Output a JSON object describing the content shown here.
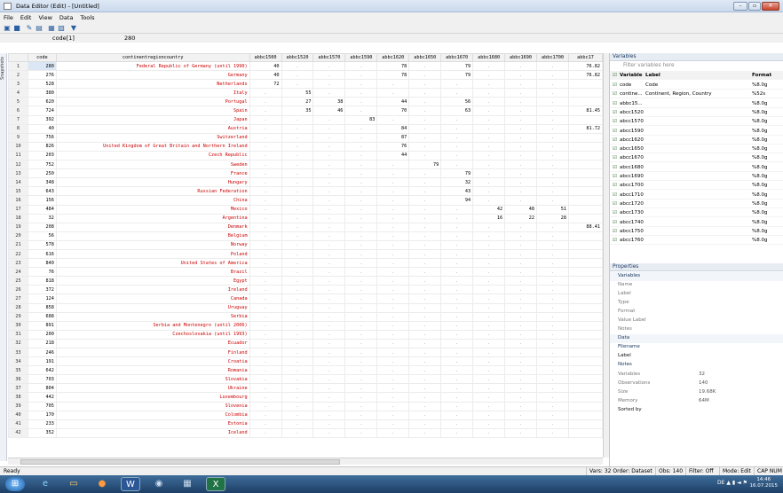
{
  "window": {
    "title": "Data Editor (Edit) - [Untitled]",
    "minimize": "–",
    "maximize": "▫",
    "close": "✕"
  },
  "menu": [
    "File",
    "Edit",
    "View",
    "Data",
    "Tools"
  ],
  "toolbar_icons": [
    "open-icon",
    "save-icon",
    "edit-icon",
    "browse-icon",
    "variables-icon",
    "properties-icon",
    "filter-icon"
  ],
  "edit_line": {
    "cell_ref": "code[1]",
    "cell_value": "280"
  },
  "snapshots_label": "Snapshots",
  "grid": {
    "columns": [
      "",
      "code",
      "continentregioncountry",
      "abbc1500",
      "abbc1520",
      "abbc1570",
      "abbc1590",
      "abbc1620",
      "abbc1650",
      "abbc1670",
      "abbc1680",
      "abbc1690",
      "abbc1700",
      "abbc17"
    ],
    "rows": [
      [
        "1",
        "280",
        "Federal Republic of Germany (until 1990)",
        "40",
        ".",
        ".",
        ".",
        "78",
        ".",
        "79",
        ".",
        ".",
        ".",
        "76.82"
      ],
      [
        "2",
        "276",
        "Germany",
        "40",
        ".",
        ".",
        ".",
        "78",
        ".",
        "79",
        ".",
        ".",
        ".",
        "76.82"
      ],
      [
        "3",
        "528",
        "Netherlands",
        "72",
        ".",
        ".",
        ".",
        ".",
        ".",
        ".",
        ".",
        ".",
        ".",
        ""
      ],
      [
        "4",
        "380",
        "Italy",
        ".",
        "55",
        ".",
        ".",
        ".",
        ".",
        ".",
        ".",
        ".",
        ".",
        ""
      ],
      [
        "5",
        "620",
        "Portugal",
        ".",
        "27",
        "38",
        ".",
        "44",
        ".",
        "56",
        ".",
        ".",
        ".",
        ""
      ],
      [
        "6",
        "724",
        "Spain",
        ".",
        "35",
        "46",
        ".",
        "70",
        ".",
        "63",
        ".",
        ".",
        ".",
        "81.45"
      ],
      [
        "7",
        "392",
        "Japan",
        ".",
        ".",
        ".",
        "83",
        ".",
        ".",
        ".",
        ".",
        ".",
        ".",
        ""
      ],
      [
        "8",
        "40",
        "Austria",
        ".",
        ".",
        ".",
        ".",
        "84",
        ".",
        ".",
        ".",
        ".",
        ".",
        "81.72"
      ],
      [
        "9",
        "756",
        "Switzerland",
        ".",
        ".",
        ".",
        ".",
        "87",
        ".",
        ".",
        ".",
        ".",
        ".",
        ""
      ],
      [
        "10",
        "826",
        "United Kingdom of Great Britain and Northern Ireland",
        ".",
        ".",
        ".",
        ".",
        "76",
        ".",
        ".",
        ".",
        ".",
        ".",
        ""
      ],
      [
        "11",
        "203",
        "Czech Republic",
        ".",
        ".",
        ".",
        ".",
        "44",
        ".",
        ".",
        ".",
        ".",
        ".",
        ""
      ],
      [
        "12",
        "752",
        "Sweden",
        ".",
        ".",
        ".",
        ".",
        ".",
        "79",
        ".",
        ".",
        ".",
        ".",
        ""
      ],
      [
        "13",
        "250",
        "France",
        ".",
        ".",
        ".",
        ".",
        ".",
        ".",
        "79",
        ".",
        ".",
        ".",
        ""
      ],
      [
        "14",
        "348",
        "Hungary",
        ".",
        ".",
        ".",
        ".",
        ".",
        ".",
        "32",
        ".",
        ".",
        ".",
        ""
      ],
      [
        "15",
        "643",
        "Russian Federation",
        ".",
        ".",
        ".",
        ".",
        ".",
        ".",
        "43",
        ".",
        ".",
        ".",
        ""
      ],
      [
        "16",
        "156",
        "China",
        ".",
        ".",
        ".",
        ".",
        ".",
        ".",
        "94",
        ".",
        ".",
        ".",
        ""
      ],
      [
        "17",
        "484",
        "Mexico",
        ".",
        ".",
        ".",
        ".",
        ".",
        ".",
        ".",
        "42",
        "48",
        "51",
        ""
      ],
      [
        "18",
        "32",
        "Argentina",
        ".",
        ".",
        ".",
        ".",
        ".",
        ".",
        ".",
        "16",
        "22",
        "28",
        ""
      ],
      [
        "19",
        "208",
        "Denmark",
        ".",
        ".",
        ".",
        ".",
        ".",
        ".",
        ".",
        ".",
        ".",
        ".",
        "88.41"
      ],
      [
        "20",
        "56",
        "Belgium",
        ".",
        ".",
        ".",
        ".",
        ".",
        ".",
        ".",
        ".",
        ".",
        ".",
        ""
      ],
      [
        "21",
        "578",
        "Norway",
        ".",
        ".",
        ".",
        ".",
        ".",
        ".",
        ".",
        ".",
        ".",
        ".",
        ""
      ],
      [
        "22",
        "616",
        "Poland",
        ".",
        ".",
        ".",
        ".",
        ".",
        ".",
        ".",
        ".",
        ".",
        ".",
        ""
      ],
      [
        "23",
        "840",
        "United States of America",
        ".",
        ".",
        ".",
        ".",
        ".",
        ".",
        ".",
        ".",
        ".",
        ".",
        ""
      ],
      [
        "24",
        "76",
        "Brazil",
        ".",
        ".",
        ".",
        ".",
        ".",
        ".",
        ".",
        ".",
        ".",
        ".",
        ""
      ],
      [
        "25",
        "818",
        "Egypt",
        ".",
        ".",
        ".",
        ".",
        ".",
        ".",
        ".",
        ".",
        ".",
        ".",
        ""
      ],
      [
        "26",
        "372",
        "Ireland",
        ".",
        ".",
        ".",
        ".",
        ".",
        ".",
        ".",
        ".",
        ".",
        ".",
        ""
      ],
      [
        "27",
        "124",
        "Canada",
        ".",
        ".",
        ".",
        ".",
        ".",
        ".",
        ".",
        ".",
        ".",
        ".",
        ""
      ],
      [
        "28",
        "858",
        "Uruguay",
        ".",
        ".",
        ".",
        ".",
        ".",
        ".",
        ".",
        ".",
        ".",
        ".",
        ""
      ],
      [
        "29",
        "688",
        "Serbia",
        ".",
        ".",
        ".",
        ".",
        ".",
        ".",
        ".",
        ".",
        ".",
        ".",
        ""
      ],
      [
        "30",
        "891",
        "Serbia and Montenegro (until 2006)",
        ".",
        ".",
        ".",
        ".",
        ".",
        ".",
        ".",
        ".",
        ".",
        ".",
        ""
      ],
      [
        "31",
        "200",
        "Czechoslovakia (until 1993)",
        ".",
        ".",
        ".",
        ".",
        ".",
        ".",
        ".",
        ".",
        ".",
        ".",
        ""
      ],
      [
        "32",
        "218",
        "Ecuador",
        ".",
        ".",
        ".",
        ".",
        ".",
        ".",
        ".",
        ".",
        ".",
        ".",
        ""
      ],
      [
        "33",
        "246",
        "Finland",
        ".",
        ".",
        ".",
        ".",
        ".",
        ".",
        ".",
        ".",
        ".",
        ".",
        ""
      ],
      [
        "34",
        "191",
        "Croatia",
        ".",
        ".",
        ".",
        ".",
        ".",
        ".",
        ".",
        ".",
        ".",
        ".",
        ""
      ],
      [
        "35",
        "642",
        "Romania",
        ".",
        ".",
        ".",
        ".",
        ".",
        ".",
        ".",
        ".",
        ".",
        ".",
        ""
      ],
      [
        "36",
        "703",
        "Slovakia",
        ".",
        ".",
        ".",
        ".",
        ".",
        ".",
        ".",
        ".",
        ".",
        ".",
        ""
      ],
      [
        "37",
        "804",
        "Ukraine",
        ".",
        ".",
        ".",
        ".",
        ".",
        ".",
        ".",
        ".",
        ".",
        ".",
        ""
      ],
      [
        "38",
        "442",
        "Luxembourg",
        ".",
        ".",
        ".",
        ".",
        ".",
        ".",
        ".",
        ".",
        ".",
        ".",
        ""
      ],
      [
        "39",
        "705",
        "Slovenia",
        ".",
        ".",
        ".",
        ".",
        ".",
        ".",
        ".",
        ".",
        ".",
        ".",
        ""
      ],
      [
        "40",
        "170",
        "Colombia",
        ".",
        ".",
        ".",
        ".",
        ".",
        ".",
        ".",
        ".",
        ".",
        ".",
        ""
      ],
      [
        "41",
        "233",
        "Estonia",
        ".",
        ".",
        ".",
        ".",
        ".",
        ".",
        ".",
        ".",
        ".",
        ".",
        ""
      ],
      [
        "42",
        "352",
        "Iceland",
        ".",
        ".",
        ".",
        ".",
        ".",
        ".",
        ".",
        ".",
        ".",
        ".",
        ""
      ]
    ]
  },
  "variables_panel": {
    "title": "Variables",
    "filter_placeholder": "Filter variables here",
    "headers": [
      "Variable",
      "Label",
      "Format"
    ],
    "items": [
      {
        "name": "code",
        "label": "Code",
        "format": "%8.0g"
      },
      {
        "name": "contine...",
        "label": "Continent, Region, Country",
        "format": "%52s"
      },
      {
        "name": "abbc15...",
        "label": "",
        "format": "%8.0g"
      },
      {
        "name": "abcc1520",
        "label": "",
        "format": "%8.0g"
      },
      {
        "name": "abcc1570",
        "label": "",
        "format": "%8.0g"
      },
      {
        "name": "abcc1590",
        "label": "",
        "format": "%8.0g"
      },
      {
        "name": "abcc1620",
        "label": "",
        "format": "%8.0g"
      },
      {
        "name": "abcc1650",
        "label": "",
        "format": "%8.0g"
      },
      {
        "name": "abcc1670",
        "label": "",
        "format": "%8.0g"
      },
      {
        "name": "abcc1680",
        "label": "",
        "format": "%8.0g"
      },
      {
        "name": "abcc1690",
        "label": "",
        "format": "%8.0g"
      },
      {
        "name": "abcc1700",
        "label": "",
        "format": "%8.0g"
      },
      {
        "name": "abcc1710",
        "label": "",
        "format": "%8.0g"
      },
      {
        "name": "abcc1720",
        "label": "",
        "format": "%8.0g"
      },
      {
        "name": "abcc1730",
        "label": "",
        "format": "%8.0g"
      },
      {
        "name": "abcc1740",
        "label": "",
        "format": "%8.0g"
      },
      {
        "name": "abcc1750",
        "label": "",
        "format": "%8.0g"
      },
      {
        "name": "abcc1760",
        "label": "",
        "format": "%8.0g"
      }
    ]
  },
  "properties_panel": {
    "title": "Properties",
    "variables_group": "Variables",
    "variable_props": [
      "Name",
      "Label",
      "Type",
      "Format",
      "Value Label",
      "Notes"
    ],
    "data_group": "Data",
    "filename_label": "Filename",
    "label_label": "Label",
    "notes_label": "Notes",
    "stats": [
      {
        "k": "Variables",
        "v": "32"
      },
      {
        "k": "Observations",
        "v": "140"
      },
      {
        "k": "Size",
        "v": "19.68K"
      },
      {
        "k": "Memory",
        "v": "64M"
      }
    ],
    "sorted_by": "Sorted by"
  },
  "status": {
    "ready": "Ready",
    "vars": "Vars: 32  Order: Dataset",
    "obs": "Obs: 140",
    "filter": "Filter: Off",
    "mode": "Mode: Edit",
    "caps": "CAP  NUM"
  },
  "taskbar": {
    "apps": [
      "windows-start-icon",
      "internet-explorer-icon",
      "file-explorer-icon",
      "firefox-icon",
      "word-icon",
      "search-app-icon",
      "stata-icon",
      "excel-icon"
    ],
    "lang": "DE",
    "time": "14:46",
    "date": "16.07.2015"
  }
}
